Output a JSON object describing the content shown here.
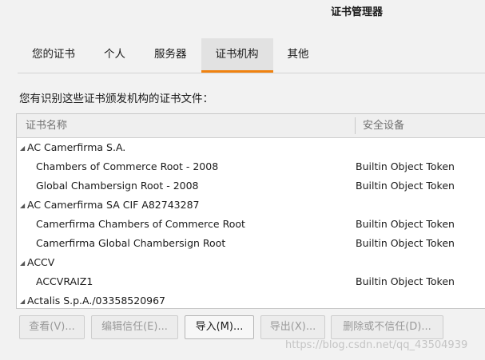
{
  "window": {
    "title": "证书管理器"
  },
  "tabs": [
    {
      "label": "您的证书",
      "active": false
    },
    {
      "label": "个人",
      "active": false
    },
    {
      "label": "服务器",
      "active": false
    },
    {
      "label": "证书机构",
      "active": true
    },
    {
      "label": "其他",
      "active": false
    }
  ],
  "description": "您有识别这些证书颁发机构的证书文件：",
  "table": {
    "columns": {
      "name": "证书名称",
      "device": "安全设备"
    },
    "rows": [
      {
        "type": "group",
        "name": "AC Camerfirma S.A.",
        "device": ""
      },
      {
        "type": "cert",
        "name": "Chambers of Commerce Root - 2008",
        "device": "Builtin Object Token"
      },
      {
        "type": "cert",
        "name": "Global Chambersign Root - 2008",
        "device": "Builtin Object Token"
      },
      {
        "type": "group",
        "name": "AC Camerfirma SA CIF A82743287",
        "device": ""
      },
      {
        "type": "cert",
        "name": "Camerfirma Chambers of Commerce Root",
        "device": "Builtin Object Token"
      },
      {
        "type": "cert",
        "name": "Camerfirma Global Chambersign Root",
        "device": "Builtin Object Token"
      },
      {
        "type": "group",
        "name": "ACCV",
        "device": ""
      },
      {
        "type": "cert",
        "name": "ACCVRAIZ1",
        "device": "Builtin Object Token"
      },
      {
        "type": "group",
        "name": "Actalis S.p.A./03358520967",
        "device": ""
      }
    ]
  },
  "buttons": {
    "view": "查看(V)...",
    "edit_trust": "编辑信任(E)...",
    "import": "导入(M)...",
    "export": "导出(X)...",
    "delete": "删除或不信任(D)..."
  },
  "watermark": "https://blog.csdn.net/qq_43504939",
  "icons": {
    "expanded_twisty": "triangle-down-left-icon"
  },
  "colors": {
    "active_tab_underline": "#f0820f",
    "active_tab_bg": "#e2e2e2"
  }
}
